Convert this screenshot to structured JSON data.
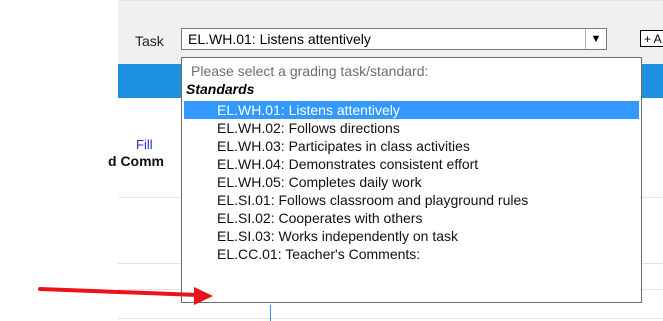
{
  "toolbar": {
    "task_label": "Task",
    "task_value": "EL.WH.01: Listens attentively",
    "dropdown_arrow": "chevron-down-icon",
    "add_button_label": "+ A"
  },
  "background": {
    "fill_link": "Fill",
    "comments_header": "d Comm"
  },
  "dropdown": {
    "placeholder": "Please select a grading task/standard:",
    "group_label": "Standards",
    "selected_index": 0,
    "items": [
      "EL.WH.01: Listens attentively",
      "EL.WH.02: Follows directions",
      "EL.WH.03: Participates in class activities",
      "EL.WH.04: Demonstrates consistent effort",
      "EL.WH.05: Completes daily work",
      "EL.SI.01: Follows classroom and playground rules",
      "EL.SI.02: Cooperates with others",
      "EL.SI.03: Works independently on task",
      "EL.CC.01: Teacher's Comments:"
    ]
  },
  "annotation": {
    "arrow_color": "#e8141a",
    "points_to_index": 8
  },
  "colors": {
    "header_blue": "#1e90e0",
    "selection_blue": "#3399ff",
    "link_blue": "#1f33cc"
  }
}
